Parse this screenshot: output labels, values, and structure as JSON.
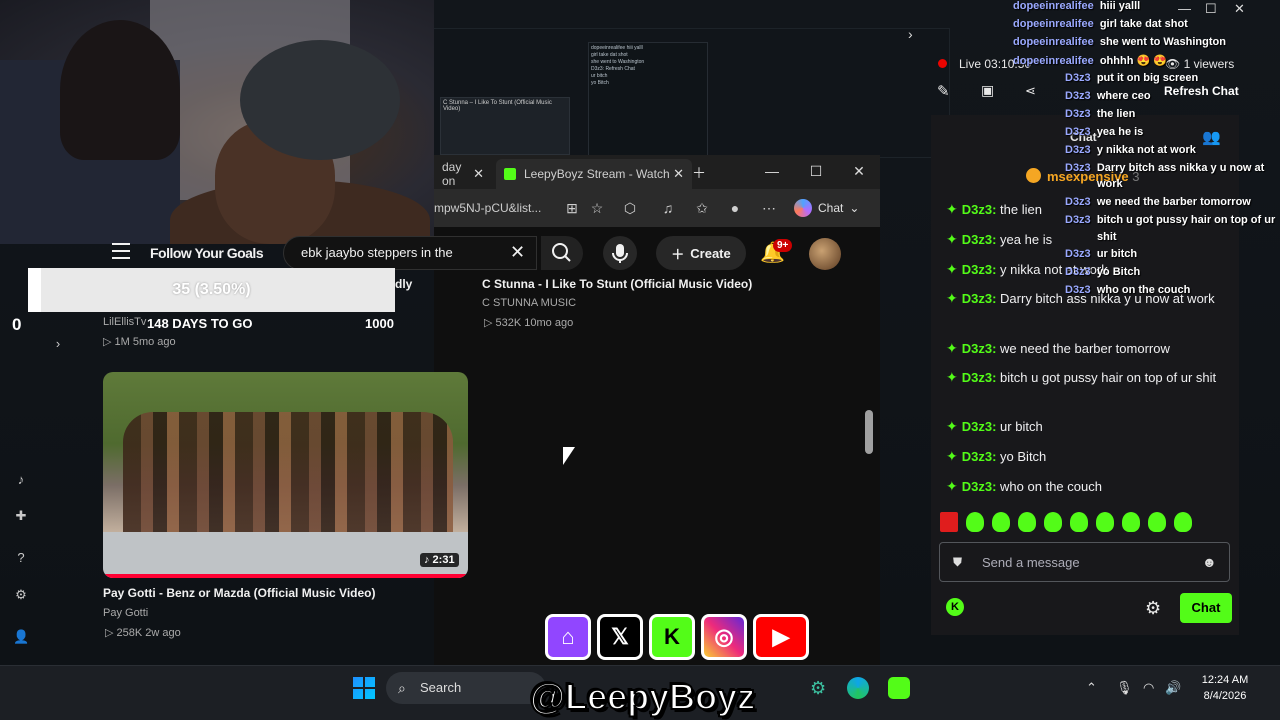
{
  "background_window": {
    "thumb1_text": "C Stunna – I Like To Stunt (Official Music Video)",
    "thumb2_lines": [
      "dopeeinrealifee hiii yalll",
      "girl take dat shot",
      "she went to Washington",
      "D3z3: Refresh Chat",
      "ur bitch",
      "yo Bitch"
    ]
  },
  "browser": {
    "tab1_label": "day on",
    "tab2_label": "LeepyBoyz Stream - Watch",
    "address": "mpw5NJ-pCU&list...",
    "chat_button": "Chat"
  },
  "youtube": {
    "overlay_label": "Follow Your Goals",
    "search_value": "ebk jaaybo steppers in the",
    "create_label": "Create",
    "notif_count": "9+",
    "videos": [
      {
        "title": "C Stunna - I Like To Stunt (Official Music Video)",
        "channel": "C STUNNA MUSIC",
        "meta": "▷ 532K   10mo ago"
      },
      {
        "title": "Pay Gotti - Benz or Mazda (Official Music Video)",
        "channel": "Pay Gotti",
        "meta": "▷ 258K   2w ago",
        "duration": "♪ 2:31"
      }
    ],
    "left_video": {
      "channel": "LilEllisTv",
      "meta": "▷ 1M   5mo ago",
      "partial_title": "dly"
    }
  },
  "goal": {
    "text": "35 (3.50%)",
    "progress": 0.035,
    "start": "0",
    "days_label": "148 DAYS TO GO",
    "target": "1000"
  },
  "stream": {
    "live_label": "Live",
    "live_time": "03:10:50",
    "viewers": "1 viewers",
    "refresh_label": "Refresh Chat",
    "chat_title": "Chat",
    "pinned_user": "msexpensive",
    "pinned_count": "3"
  },
  "chat": {
    "messages": [
      {
        "user": "D3z3:",
        "text": "the lien"
      },
      {
        "user": "D3z3:",
        "text": "yea he is"
      },
      {
        "user": "D3z3:",
        "text": "y nikka not at work"
      },
      {
        "user": "D3z3:",
        "text": "Darry bitch ass nikka y u now at work"
      },
      {
        "user": "D3z3:",
        "text": "we need the barber tomorrow"
      },
      {
        "user": "D3z3:",
        "text": "bitch u got pussy hair on top of ur shit"
      },
      {
        "user": "D3z3:",
        "text": "ur bitch"
      },
      {
        "user": "D3z3:",
        "text": "yo Bitch"
      },
      {
        "user": "D3z3:",
        "text": "who on the couch"
      }
    ],
    "input_placeholder": "Send a message",
    "send_label": "Chat"
  },
  "overlay_chat": [
    {
      "user": "dopeeinrealifee",
      "text": "hiii yalll"
    },
    {
      "user": "dopeeinrealifee",
      "text": "girl take dat shot"
    },
    {
      "user": "dopeeinrealifee",
      "text": "she went to Washington"
    },
    {
      "user": "dopeeinrealifee",
      "text": "ohhhh 😍 😍"
    },
    {
      "user": "D3z3",
      "text": "put it on big screen"
    },
    {
      "user": "D3z3",
      "text": "where ceo"
    },
    {
      "user": "D3z3",
      "text": "the lien"
    },
    {
      "user": "D3z3",
      "text": "yea he is"
    },
    {
      "user": "D3z3",
      "text": "y nikka not at work"
    },
    {
      "user": "D3z3",
      "text": "Darry bitch ass nikka y u now at"
    },
    {
      "user": "",
      "text": "work"
    },
    {
      "user": "D3z3",
      "text": "we need the barber tomorrow"
    },
    {
      "user": "D3z3",
      "text": "bitch u got pussy hair on top of ur"
    },
    {
      "user": "",
      "text": "shit"
    },
    {
      "user": "D3z3",
      "text": "ur bitch"
    },
    {
      "user": "D3z3",
      "text": "yo Bitch"
    },
    {
      "user": "D3z3",
      "text": "who on the couch"
    }
  ],
  "taskbar": {
    "search_label": "Search",
    "time": "12:24 AM",
    "date": "8/4/2026"
  },
  "social": {
    "handle": "@LeepyBoyz"
  },
  "colors": {
    "kick_green": "#53fc18",
    "youtube_red": "#ff0033",
    "twitch_purple": "#9146ff"
  }
}
